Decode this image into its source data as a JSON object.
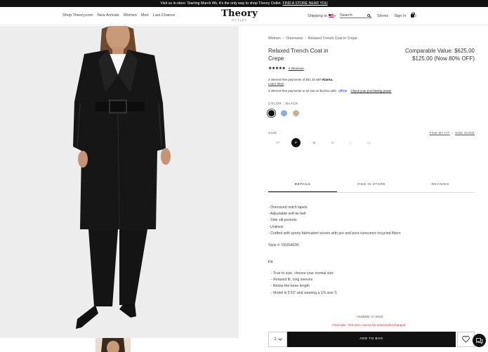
{
  "promo": {
    "text": "Visit us in-store: Starting March 4th, it's the only way to shop Theory Outlet.",
    "link": "FIND A STORE NEAR YOU"
  },
  "nav": [
    "Shop Theory.com",
    "New Arrivals",
    "Women",
    "Men",
    "Last Chance"
  ],
  "logo": {
    "name": "Theory",
    "sub": "OUTLET"
  },
  "util": {
    "shipping": "Shipping to",
    "search_placeholder": "Search",
    "stores": "Stores",
    "signin": "Sign In",
    "bag_count": "0"
  },
  "product": {
    "breadcrumbs": [
      "Women",
      "Outerwear",
      "Relaxed Trench Coat in Crepe"
    ],
    "title": "Relaxed Trench Coat in Crepe",
    "comparable": "Comparable Value: $625.00",
    "price": "$125.00 (Now 80% OFF)",
    "rating": 5,
    "stars": "★★★★★",
    "reviews": "4 Reviews",
    "klarna_text": "4 interest-free payments of $31.25 with",
    "klarna_brand": "Klarna.",
    "learn_more": "Learn More",
    "affirm_text": "4 interest-free payments or as low as $12/mo with",
    "affirm_brand": "affirm",
    "affirm_cta": "Check your purchasing power",
    "color_label": "COLOR : BLACK",
    "colors": {
      "black": "#111111",
      "blue": "#8eaed6",
      "tan": "#c9b09a"
    },
    "size_label": "SIZE",
    "fit_link": "FIND MY FIT",
    "guide_link": "SIZE GUIDE",
    "sizes": [
      "XP",
      "P",
      "S",
      "M",
      "L",
      "XL"
    ],
    "selected_size": "P"
  },
  "tabs": [
    "DETAILS",
    "FIND IN STORE",
    "REVIEWS"
  ],
  "details": {
    "features": [
      "- Oversized notch lapels",
      "- Adjustable self-tie belt",
      "- Side slit pockets",
      "- Unlined",
      "- Crafted with sporty fabrication woven with pre and post-consumer recycled fibers"
    ],
    "style": "Style #: O025402R",
    "fit_title": "Fit",
    "fit": [
      "- True to size, choose your normal size",
      "- Relaxed fit, long sleeves",
      "- Below-the-knee length",
      "- Model is 5'10\" and wearing a US size S"
    ]
  },
  "purchase": {
    "availability": "Available: In Stock",
    "final_sale": "Final sale. This item cannot be returned/exchanged",
    "qty": "1",
    "add_to_bag": "ADD TO BAG"
  }
}
